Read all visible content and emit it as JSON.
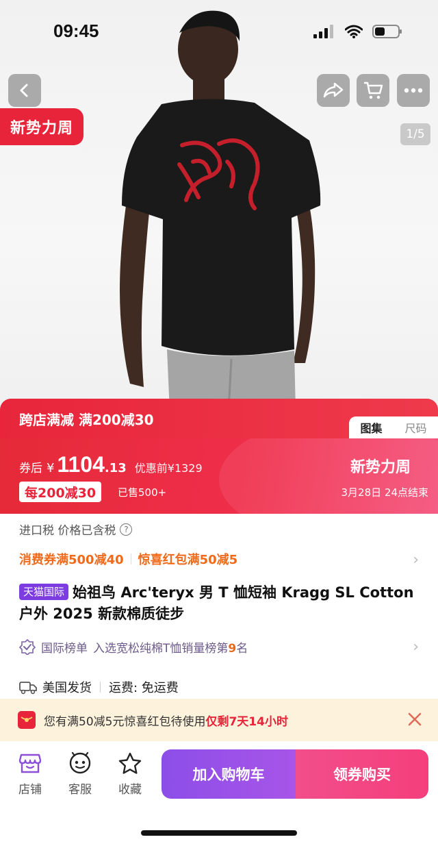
{
  "status": {
    "time": "09:45"
  },
  "top_nav": {
    "back_icon": "chevron-left-icon",
    "share_icon": "share-icon",
    "cart_icon": "cart-icon",
    "more_icon": "more-icon"
  },
  "hero": {
    "promo_tag": "新势力周",
    "page_counter": "1/5"
  },
  "promo_bar": {
    "text": "跨店满减 满200减30",
    "tabs": [
      "图集",
      "尺码"
    ],
    "active_tab": "图集"
  },
  "price": {
    "prefix": "券后",
    "currency": "¥",
    "integer": "1104",
    "decimal": ".13",
    "original": "优惠前¥1329",
    "discount_badge": "每200减30",
    "sold": "已售500+",
    "event_title": "新势力周",
    "event_end": "3月28日 24点结束"
  },
  "details": {
    "tax": "进口税 价格已含税",
    "coupon_1": "消费券满500减40",
    "coupon_2": "惊喜红包满50减5",
    "tmall_badge": "天猫国际",
    "title": "始祖鸟 Arc'teryx 男 T 恤短袖 Kragg SL Cotton 户外 2025 新款棉质徒步",
    "rank_prefix": "国际榜单",
    "rank_text": "入选宽松纯棉T恤销量榜第",
    "rank_number": "9",
    "rank_suffix": "名",
    "ship_from": "美国发货",
    "shipping": "运费: 免运费"
  },
  "red_packet": {
    "text": "您有满50减5元惊喜红包待使用",
    "highlight": "仅剩7天14小时"
  },
  "bottom_bar": {
    "store": "店铺",
    "service": "客服",
    "favorite": "收藏",
    "add_to_cart": "加入购物车",
    "buy": "领券购买"
  },
  "colors": {
    "brand_red": "#e8243a",
    "purple": "#8c4ee8",
    "pink": "#f24e8a",
    "orange": "#f06a1a"
  }
}
